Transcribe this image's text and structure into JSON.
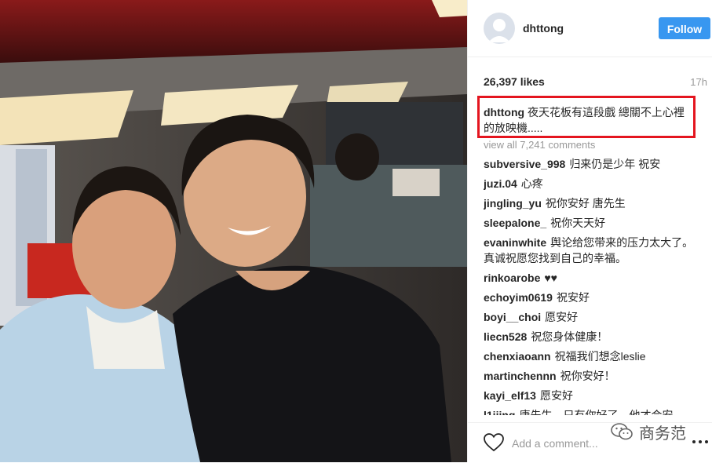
{
  "post": {
    "username": "dhttong",
    "follow_label": "Follow",
    "likes": "26,397 likes",
    "time": "17h",
    "caption_user": "dhttong",
    "caption_text": "夜天花板有這段戲 總關不上心裡的放映機.....",
    "view_all": "view all 7,241 comments",
    "add_comment_placeholder": "Add a comment...",
    "accent_color": "#3897f0",
    "highlight_color": "#e4151f"
  },
  "comments": [
    {
      "user": "subversive_998",
      "text": "归来仍是少年 祝安"
    },
    {
      "user": "juzi.04",
      "text": "心疼"
    },
    {
      "user": "jingling_yu",
      "text": "祝你安好 唐先生"
    },
    {
      "user": "sleepalone_",
      "text": "祝你天天好"
    },
    {
      "user": "evaninwhite",
      "text": "舆论给您带来的压力太大了。真诚祝愿您找到自己的幸福。"
    },
    {
      "user": "rinkoarobe",
      "text": "♥♥"
    },
    {
      "user": "echoyim0619",
      "text": "祝安好"
    },
    {
      "user": "boyi__choi",
      "text": "愿安好"
    },
    {
      "user": "liecn528",
      "text": "祝您身体健康！"
    },
    {
      "user": "chenxiaoann",
      "text": "祝福我们想念leslie"
    },
    {
      "user": "martinchennn",
      "text": "祝你安好！"
    },
    {
      "user": "kayi_elf13",
      "text": "愿安好"
    },
    {
      "user": "l1jiing",
      "text": "唐先生，只有你好了，他才会安"
    }
  ],
  "watermark": {
    "text": "商务范",
    "icon": "wechat-icon"
  },
  "icons": {
    "heart": "heart-icon",
    "more": "more-options-icon",
    "avatar": "avatar-placeholder-icon"
  }
}
